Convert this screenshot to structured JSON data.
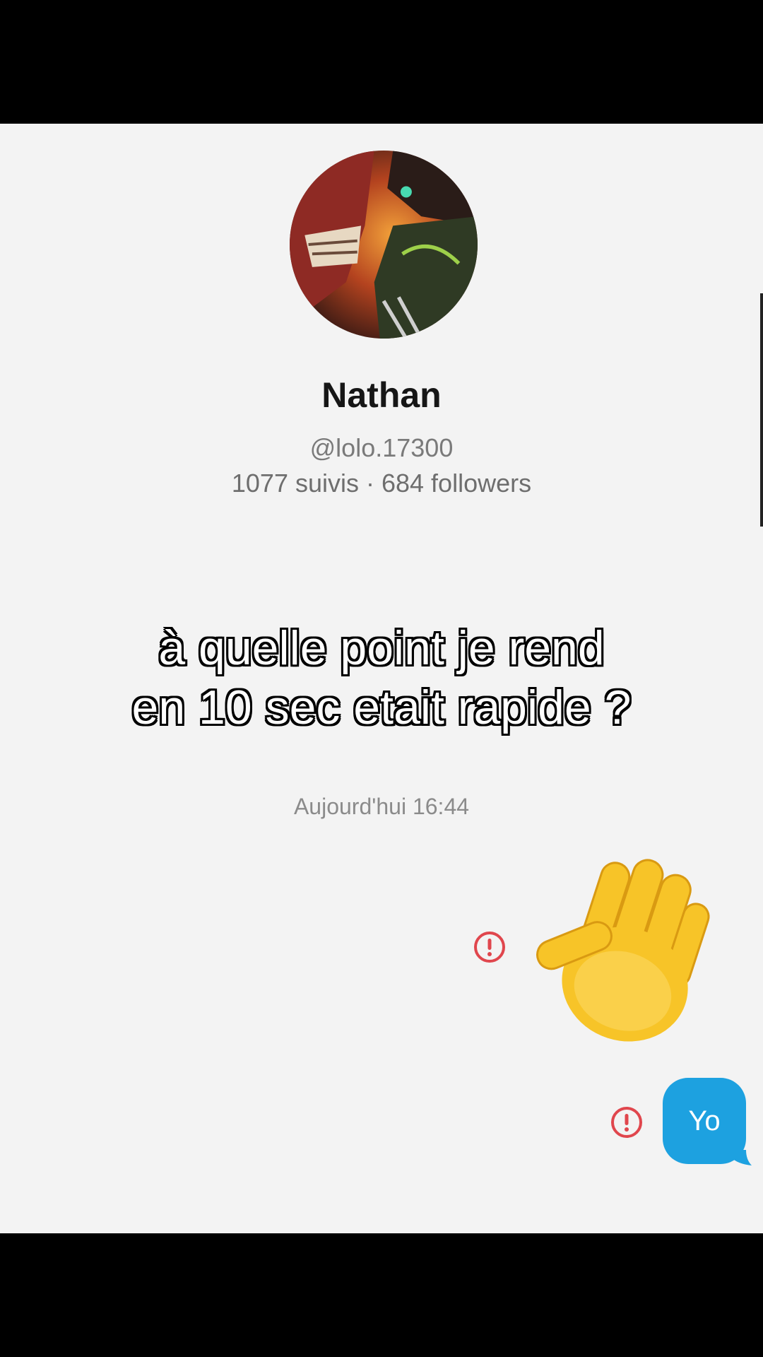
{
  "profile": {
    "name": "Nathan",
    "handle": "@lolo.17300",
    "stats": "1077 suivis · 684 followers"
  },
  "overlay_caption": {
    "line1": "à quelle point je rend",
    "line2": "en 10 sec etait rapide ?"
  },
  "chat": {
    "timestamp": "Aujourd'hui 16:44",
    "messages": [
      {
        "type": "emoji",
        "icon": "waving-hand-icon",
        "status": "failed"
      },
      {
        "type": "text",
        "text": "Yo",
        "status": "failed"
      }
    ]
  },
  "colors": {
    "background": "#f3f3f3",
    "bubble": "#1da1e0",
    "error": "#e0464d"
  }
}
